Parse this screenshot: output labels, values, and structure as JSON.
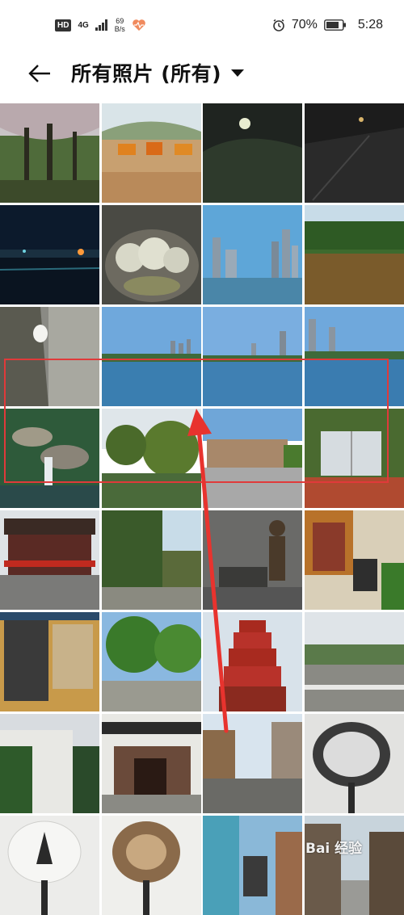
{
  "status_bar": {
    "hd": "HD",
    "network": "4G",
    "net_speed_value": "69",
    "net_speed_unit": "B/s",
    "battery_percent": "70%",
    "time": "5:28"
  },
  "header": {
    "title": "所有照片 (所有)"
  },
  "watermark": "Bai 经验",
  "colors": {
    "highlight_red": "#e03a3a",
    "arrow_red": "#e8332e"
  },
  "photos": [
    {
      "name": "forest-canopy"
    },
    {
      "name": "plaza-cafe"
    },
    {
      "name": "night-tree"
    },
    {
      "name": "night-road"
    },
    {
      "name": "night-river"
    },
    {
      "name": "succulent-pot"
    },
    {
      "name": "skyline-lake"
    },
    {
      "name": "tulip-garden"
    },
    {
      "name": "riverside-dog"
    },
    {
      "name": "lake-skyline"
    },
    {
      "name": "lake-towers"
    },
    {
      "name": "lakeside-city"
    },
    {
      "name": "rock-waterfall"
    },
    {
      "name": "pond-trees"
    },
    {
      "name": "museum-square"
    },
    {
      "name": "stone-book"
    },
    {
      "name": "ancient-gate"
    },
    {
      "name": "tree-lane"
    },
    {
      "name": "bronze-statue"
    },
    {
      "name": "red-shopfront"
    },
    {
      "name": "shop-signboard"
    },
    {
      "name": "street-trees"
    },
    {
      "name": "red-pagoda"
    },
    {
      "name": "stone-bridge"
    },
    {
      "name": "white-houses"
    },
    {
      "name": "old-street-gate"
    },
    {
      "name": "ancient-street"
    },
    {
      "name": "feather-fan-black"
    },
    {
      "name": "feather-fan-white"
    },
    {
      "name": "feather-fan-brown"
    },
    {
      "name": "tea-shop"
    },
    {
      "name": "narrow-alley"
    }
  ]
}
